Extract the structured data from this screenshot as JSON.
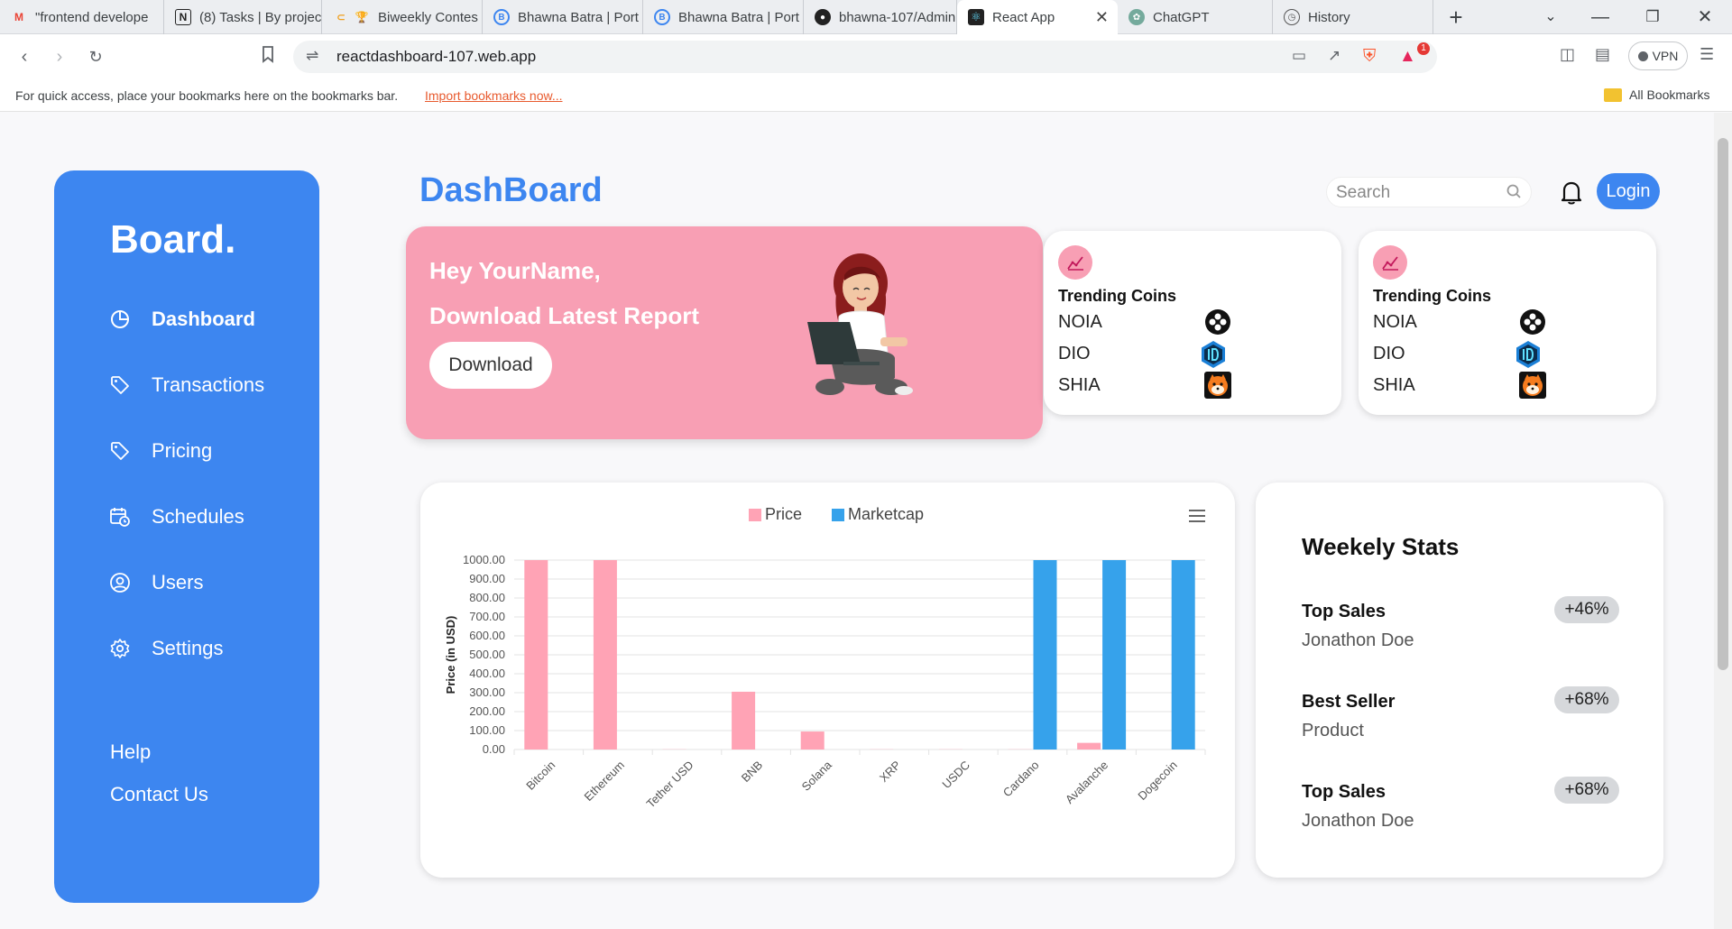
{
  "browser": {
    "tabs": [
      {
        "title": "\"frontend develope",
        "icon": "gmail-icon"
      },
      {
        "title": "(8) Tasks | By projec",
        "icon": "notion-icon"
      },
      {
        "title": "Biweekly Contes",
        "icon": "trophy-icon"
      },
      {
        "title": "Bhawna Batra | Port",
        "icon": "portfolio-icon"
      },
      {
        "title": "Bhawna Batra | Port",
        "icon": "portfolio-icon"
      },
      {
        "title": "bhawna-107/Admin",
        "icon": "github-icon"
      },
      {
        "title": "React App",
        "icon": "react-icon",
        "active": true
      },
      {
        "title": "ChatGPT",
        "icon": "chatgpt-icon"
      },
      {
        "title": "History",
        "icon": "history-icon"
      }
    ],
    "url": "reactdashboard-107.web.app",
    "vpn_label": "VPN",
    "notification_badge": "1",
    "bookmarks_bar": {
      "message": "For quick access, place your bookmarks here on the bookmarks bar.",
      "link": "Import bookmarks now...",
      "all_bookmarks": "All Bookmarks"
    }
  },
  "sidebar": {
    "brand": "Board.",
    "nav": [
      {
        "label": "Dashboard",
        "icon": "pie-chart-icon",
        "active": true
      },
      {
        "label": "Transactions",
        "icon": "tag-icon"
      },
      {
        "label": "Pricing",
        "icon": "tag-icon"
      },
      {
        "label": "Schedules",
        "icon": "calendar-clock-icon"
      },
      {
        "label": "Users",
        "icon": "user-circle-icon"
      },
      {
        "label": "Settings",
        "icon": "gear-icon"
      }
    ],
    "footer": [
      "Help",
      "Contact Us"
    ]
  },
  "header": {
    "title": "DashBoard",
    "search_placeholder": "Search",
    "login_label": "Login"
  },
  "hero": {
    "greeting": "Hey YourName,",
    "subtitle": "Download Latest Report",
    "button": "Download"
  },
  "trending_cards": [
    {
      "title": "Trending Coins",
      "coins": [
        {
          "name": "NOIA",
          "logo": "noia-logo-icon"
        },
        {
          "name": "DIO",
          "logo": "dio-logo-icon"
        },
        {
          "name": "SHIA",
          "logo": "shia-logo-icon"
        }
      ]
    },
    {
      "title": "Trending Coins",
      "coins": [
        {
          "name": "NOIA",
          "logo": "noia-logo-icon"
        },
        {
          "name": "DIO",
          "logo": "dio-logo-icon"
        },
        {
          "name": "SHIA",
          "logo": "shia-logo-icon"
        }
      ]
    }
  ],
  "chart_data": {
    "type": "bar",
    "title": "",
    "xlabel": "",
    "ylabel": "Price (in USD)",
    "ylim": [
      0,
      1000
    ],
    "yticks": [
      "0.00",
      "100.00",
      "200.00",
      "300.00",
      "400.00",
      "500.00",
      "600.00",
      "700.00",
      "800.00",
      "900.00",
      "1000.00"
    ],
    "categories": [
      "Bitcoin",
      "Ethereum",
      "Tether USD",
      "BNB",
      "Solana",
      "XRP",
      "USDC",
      "Cardano",
      "Avalanche",
      "Dogecoin"
    ],
    "series": [
      {
        "name": "Price",
        "color": "#ffa3b5",
        "values": [
          1000,
          1000,
          1,
          305,
          95,
          1,
          1,
          1,
          35,
          0
        ]
      },
      {
        "name": "Marketcap",
        "color": "#36a2eb",
        "values": [
          0,
          0,
          0,
          0,
          0,
          0,
          0,
          1000,
          1000,
          1000
        ]
      }
    ],
    "legend": "top",
    "grid": true
  },
  "weekly_stats": {
    "title": "Weekely Stats",
    "items": [
      {
        "label": "Top Sales",
        "sub": "Jonathon Doe",
        "badge": "+46%"
      },
      {
        "label": "Best Seller",
        "sub": "Product",
        "badge": "+68%"
      },
      {
        "label": "Top Sales",
        "sub": "Jonathon Doe",
        "badge": "+68%"
      }
    ]
  },
  "colors": {
    "accent": "#3d86f0",
    "hero": "#f89fb4",
    "price": "#ffa3b5",
    "marketcap": "#36a2eb"
  }
}
